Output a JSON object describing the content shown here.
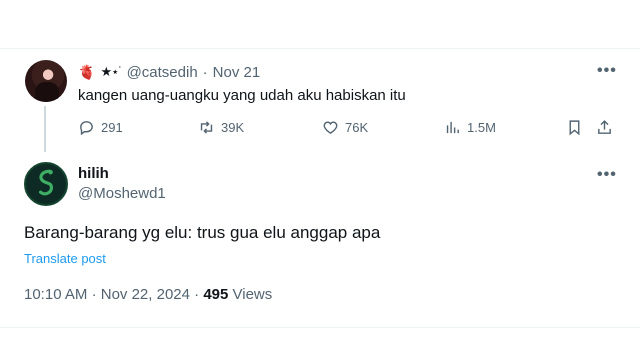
{
  "colors": {
    "accent": "#1d9bf0",
    "secondary_text": "#536471",
    "primary_text": "#0f1419",
    "thread_line": "#cfd9de"
  },
  "parent_tweet": {
    "emoji_heart": "🫀",
    "stars": "★⋆˙",
    "handle": "@catsedih",
    "separator": "·",
    "date": "Nov 21",
    "text": "kangen uang-uangku yang udah aku habiskan itu",
    "more_icon": "more-horizontal-icon",
    "actions": {
      "replies": "291",
      "reposts": "39K",
      "likes": "76K",
      "views": "1.5M"
    }
  },
  "reply_tweet": {
    "display_name": "hilih",
    "handle": "@Moshewd1",
    "text": "Barang-barang yg elu: trus gua elu anggap apa",
    "translate_label": "Translate post",
    "time": "10:10 AM",
    "dot1": "·",
    "date": "Nov 22, 2024",
    "dot2": "·",
    "views_count": "495",
    "views_label": "Views"
  }
}
